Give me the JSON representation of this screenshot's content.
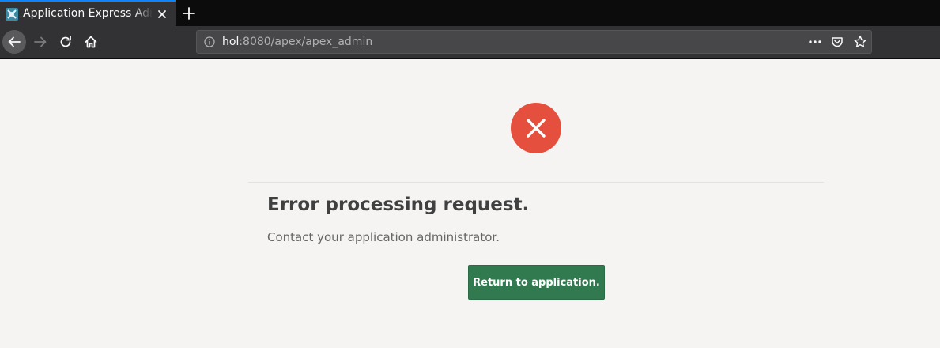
{
  "browser": {
    "tab": {
      "title": "Application Express Administration",
      "favicon": "apex-favicon-icon"
    },
    "address_bar": {
      "host": "hol",
      "path": ":8080/apex/apex_admin"
    },
    "icons": [
      "back-arrow-icon",
      "forward-arrow-icon",
      "reload-icon",
      "home-icon",
      "site-info-icon",
      "more-actions-icon",
      "pocket-icon",
      "bookmark-star-icon",
      "close-icon",
      "plus-icon"
    ]
  },
  "page": {
    "status_icon": "error-x-icon",
    "error_title": "Error processing request.",
    "error_message": "Contact your application administrator.",
    "return_button_label": "Return to application."
  },
  "colors": {
    "error_red": "#e5503e",
    "button_green": "#317a4f",
    "tab_accent": "#0a84ff",
    "page_background": "#f5f4f2"
  }
}
